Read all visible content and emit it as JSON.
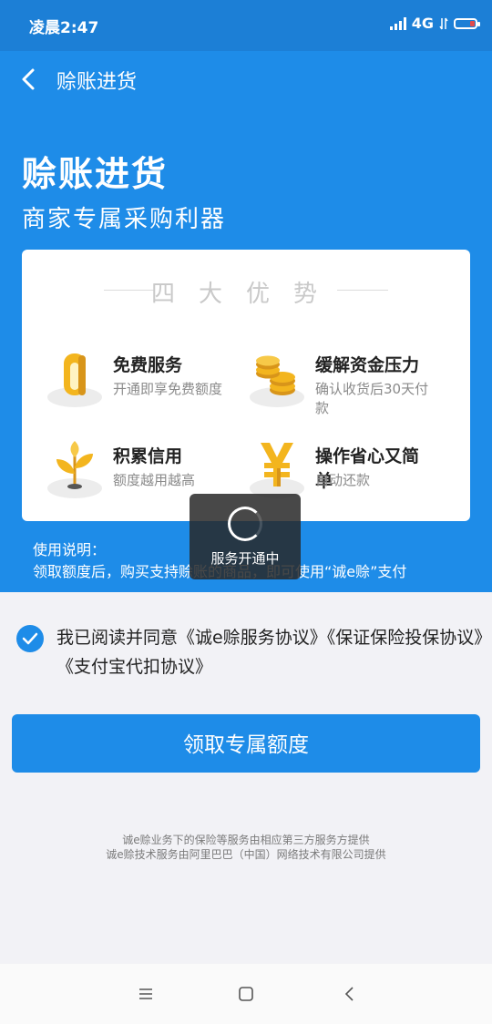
{
  "status": {
    "time": "凌晨2:47",
    "network": "4G"
  },
  "nav": {
    "title": "赊账进货"
  },
  "hero": {
    "title": "赊账进货",
    "subtitle": "商家专属采购利器"
  },
  "advantages": {
    "heading": "四大优势",
    "items": [
      {
        "title": "免费服务",
        "desc": "开通即享免费额度"
      },
      {
        "title": "缓解资金压力",
        "desc": "确认收货后30天付款"
      },
      {
        "title": "积累信用",
        "desc": "额度越用越高"
      },
      {
        "title": "操作省心又简单",
        "desc": "自动还款"
      }
    ]
  },
  "usage": {
    "label": "使用说明：",
    "text": "领取额度后，购买支持赊账的商品，即可使用“诚e赊”支付"
  },
  "toast": {
    "text": "服务开通中"
  },
  "agreement": {
    "text": "我已阅读并同意《诚e赊服务协议》《保证保险投保协议》《支付宝代扣协议》",
    "checked": true
  },
  "cta": {
    "label": "领取专属额度"
  },
  "footer": {
    "line1": "诚e赊业务下的保险等服务由相应第三方服务方提供",
    "line2": "诚e赊技术服务由阿里巴巴（中国）网络技术有限公司提供"
  },
  "colors": {
    "primary": "#1e8ce8",
    "status_bar": "#1c7fd6",
    "gold": "#f3b51e"
  }
}
